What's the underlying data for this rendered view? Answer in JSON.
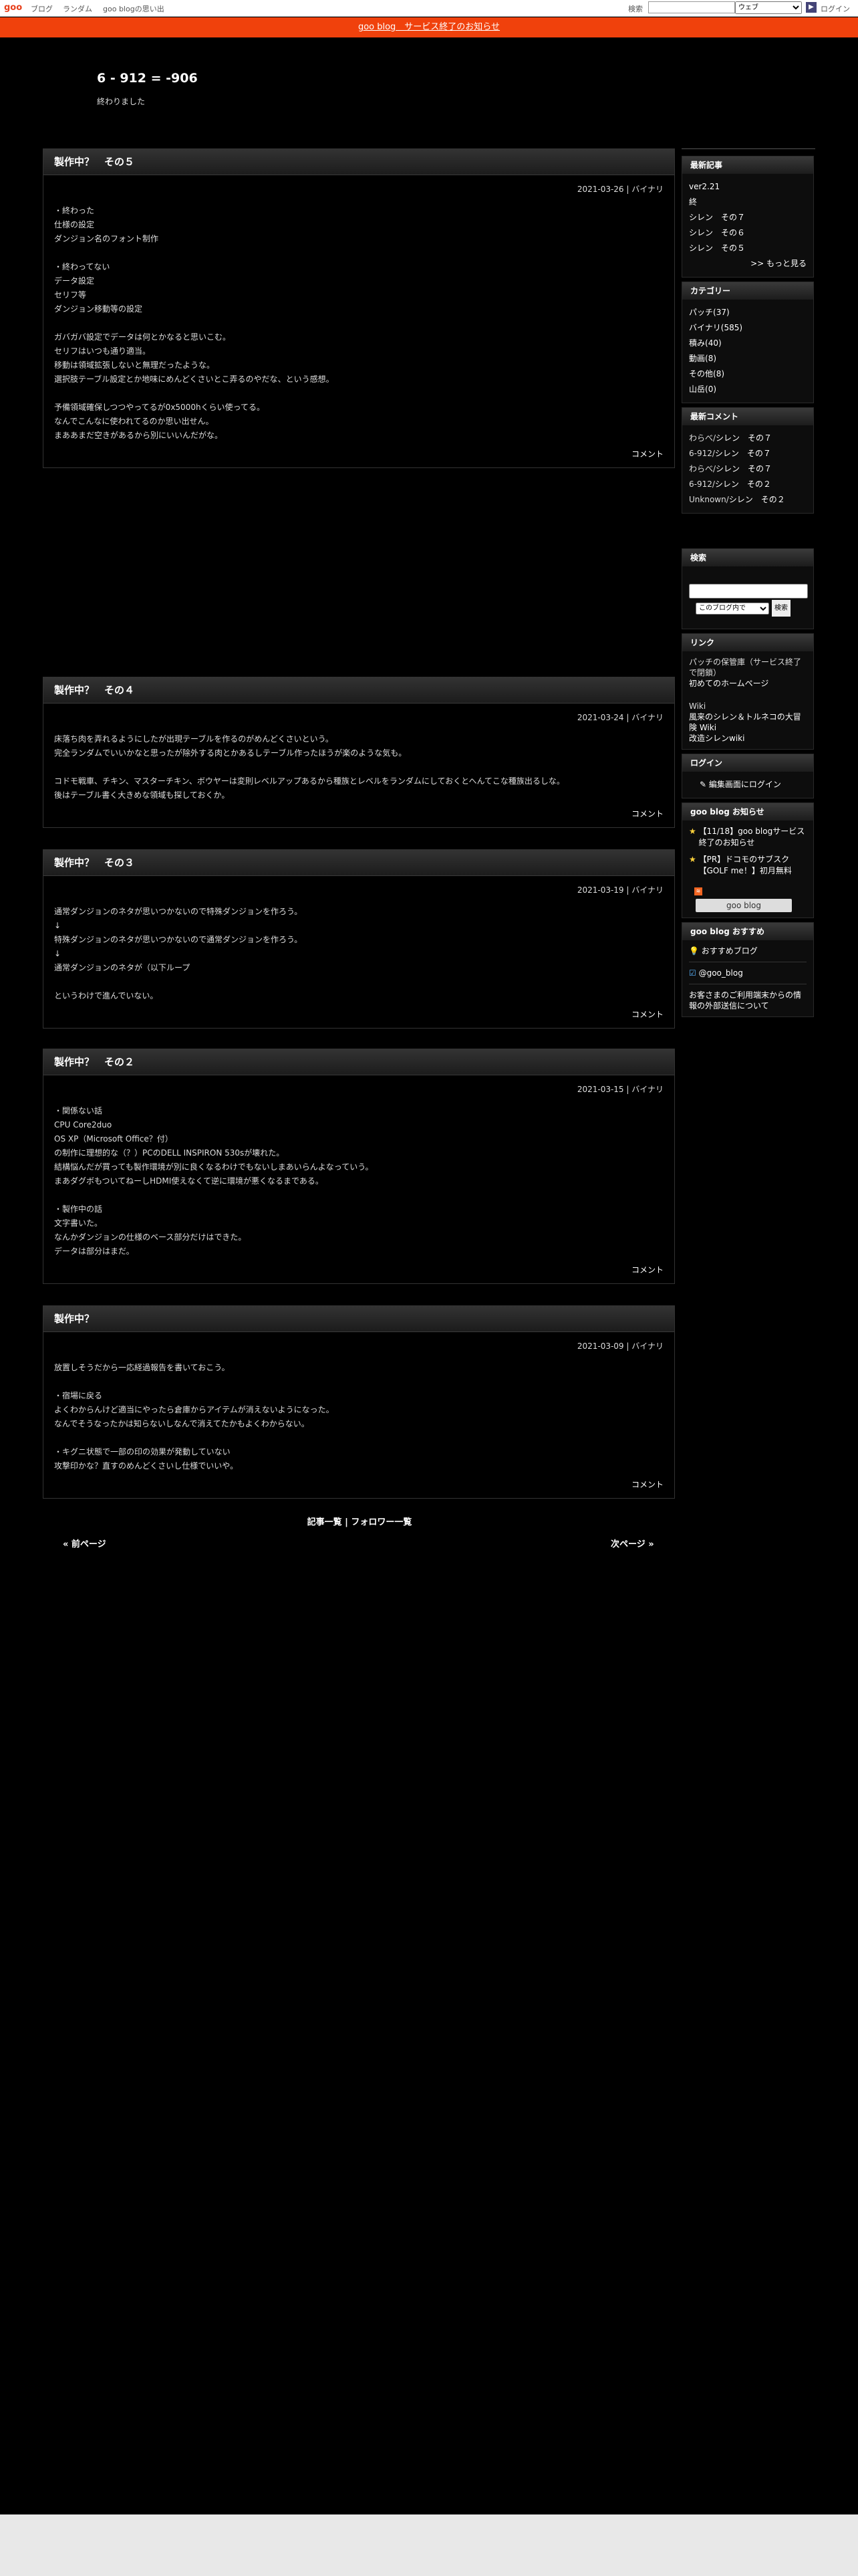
{
  "topbar": {
    "logo": "goo",
    "nav": [
      "ブログ",
      "ランダム",
      "goo blogの思い出"
    ],
    "search_label": "検索",
    "search_select": "ウェブ",
    "login": "ログイン"
  },
  "notice": "goo blog　サービス終了のお知らせ",
  "header": {
    "title": "6 - 912 = -906",
    "description": "終わりました"
  },
  "posts": [
    {
      "title": "製作中？　その５",
      "meta": "2021-03-26 | バイナリ",
      "body": "・終わった\n仕様の設定\nダンジョン名のフォント制作\n\n・終わってない\nデータ設定\nセリフ等\nダンジョン移動等の設定\n\nガバガバ設定でデータは何とかなると思いこむ。\nセリフはいつも通り適当。\n移動は領域拡張しないと無理だったような。\n選択肢テーブル設定とか地味にめんどくさいとこ弄るのやだな、という感想。\n\n予備領域確保しつつやってるが0x5000hくらい使ってる。\nなんでこんなに使われてるのか思い出せん。\nまああまだ空きがあるから別にいいんだがな。",
      "comment": "コメント"
    },
    {
      "title": "製作中？　その４",
      "meta": "2021-03-24 | バイナリ",
      "body": "床落ち肉を弄れるようにしたが出現テーブルを作るのがめんどくさいという。\n完全ランダムでいいかなと思ったが除外する肉とかあるしテーブル作ったほうが楽のような気も。\n\nコドモ戦車、チキン、マスターチキン、ボウヤーは変則レベルアップあるから種族とレベルをランダムにしておくとへんてこな種族出るしな。\n後はテーブル書く大きめな領域も探しておくか。",
      "comment": "コメント"
    },
    {
      "title": "製作中？　その３",
      "meta": "2021-03-19 | バイナリ",
      "body": "通常ダンジョンのネタが思いつかないので特殊ダンジョンを作ろう。\n↓\n特殊ダンジョンのネタが思いつかないので通常ダンジョンを作ろう。\n↓\n通常ダンジョンのネタが（以下ループ\n\nというわけで進んでいない。",
      "comment": "コメント"
    },
    {
      "title": "製作中？　その２",
      "meta": "2021-03-15 | バイナリ",
      "body": "・関係ない話\nCPU Core2duo\nOS XP（Microsoft Office？付）\nの制作に理想的な（？）PCのDELL INSPIRON 530sが壊れた。\n結構悩んだが買っても製作環境が別に良くなるわけでもないしまあいらんよなっていう。\nまあダグボもついてねーしHDMI使えなくて逆に環境が悪くなるまである。\n\n・製作中の話\n文字書いた。\nなんかダンジョンの仕様のベース部分だけはできた。\nデータは部分はまだ。",
      "comment": "コメント"
    },
    {
      "title": "製作中？",
      "meta": "2021-03-09 | バイナリ",
      "body": "放置しそうだから一応経過報告を書いておこう。\n\n・宿場に戻る\nよくわからんけど適当にやったら倉庫からアイテムが消えないようになった。\nなんでそうなったかは知らないしなんで消えてたかもよくわからない。\n\n・キグニ状態で一部の印の効果が発動していない\n攻撃印かな？直すのめんどくさいし仕様でいいや。",
      "comment": "コメント"
    }
  ],
  "sidebar": {
    "recent": {
      "heading": "最新記事",
      "items": [
        "ver2.21",
        "終",
        "シレン　その７",
        "シレン　その６",
        "シレン　その５"
      ],
      "more": ">> もっと見る"
    },
    "categories": {
      "heading": "カテゴリー",
      "items": [
        {
          "name": "パッチ",
          "count": "(37)"
        },
        {
          "name": "バイナリ",
          "count": "(585)"
        },
        {
          "name": "積み",
          "count": "(40)"
        },
        {
          "name": "動画",
          "count": "(8)"
        },
        {
          "name": "その他",
          "count": "(8)"
        },
        {
          "name": "山岳",
          "count": "(0)"
        }
      ]
    },
    "comments": {
      "heading": "最新コメント",
      "items": [
        {
          "who": "わらべ/",
          "post": "シレン　その７"
        },
        {
          "who": "6-912/",
          "post": "シレン　その７"
        },
        {
          "who": "わらべ/",
          "post": "シレン　その７"
        },
        {
          "who": "6-912/",
          "post": "シレン　その２"
        },
        {
          "who": "Unknown/",
          "post": "シレン　その２"
        }
      ]
    },
    "search": {
      "heading": "検索",
      "select": "このブログ内で",
      "button": "検索"
    },
    "links": {
      "heading": "リンク",
      "desc": "パッチの保管庫（サービス終了で閉鎖）",
      "link1": "初めてのホームページ",
      "wiki_label": "Wiki",
      "link2": "風来のシレン＆トルネコの大冒険 Wiki",
      "link3": "改造シレンwiki"
    },
    "login": {
      "heading": "ログイン",
      "link": "編集画面にログイン"
    },
    "goo_notice": {
      "heading": "goo blog お知らせ",
      "items": [
        "【11/18】goo blogサービス終了のお知らせ",
        "【PR】ドコモのサブスク【GOLF me！】初月無料"
      ],
      "badge": "goo blog"
    },
    "goo_reco": {
      "heading": "goo blog おすすめ",
      "item1": "おすすめブログ",
      "item2": "@goo_blog",
      "item3": "お客さまのご利用端末からの情報の外部送信について"
    }
  },
  "footer": {
    "list": "記事一覧",
    "sep": " | ",
    "follow": "フォロワー一覧",
    "prev": "« 前ページ",
    "next": "次ページ »"
  }
}
